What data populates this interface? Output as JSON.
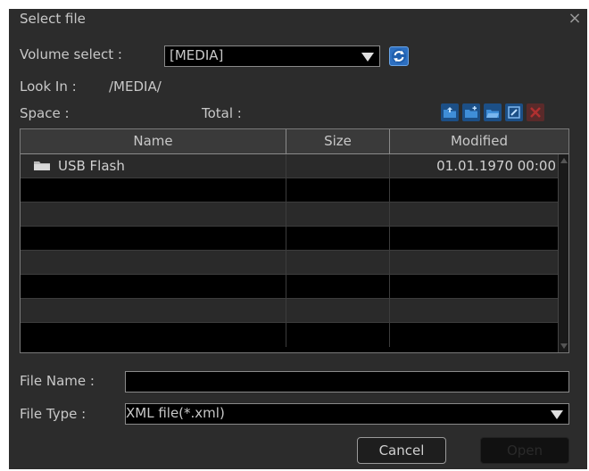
{
  "dialog": {
    "title": "Select file",
    "close_glyph": "×"
  },
  "volume": {
    "label": "Volume select :",
    "selected": "[MEDIA]"
  },
  "look_in": {
    "label": "Look In :",
    "path": "/MEDIA/"
  },
  "space": {
    "label": "Space :",
    "total_label": "Total :"
  },
  "toolbar": {
    "icons": [
      "folder-up-icon",
      "new-folder-icon",
      "folder-open-icon",
      "rename-icon",
      "delete-icon"
    ]
  },
  "table": {
    "columns": [
      "Name",
      "Size",
      "Modified"
    ],
    "rows": [
      {
        "name": "USB Flash",
        "size": "",
        "modified": "01.01.1970 00:00",
        "icon": "folder-icon"
      }
    ]
  },
  "file_name": {
    "label": "File Name :",
    "value": ""
  },
  "file_type": {
    "label": "File Type :",
    "selected": "XML file(*.xml)"
  },
  "buttons": {
    "cancel": "Cancel",
    "open": "Open"
  },
  "colors": {
    "dialog_bg": "#2c2c2c",
    "accent": "#2d6fc0"
  }
}
